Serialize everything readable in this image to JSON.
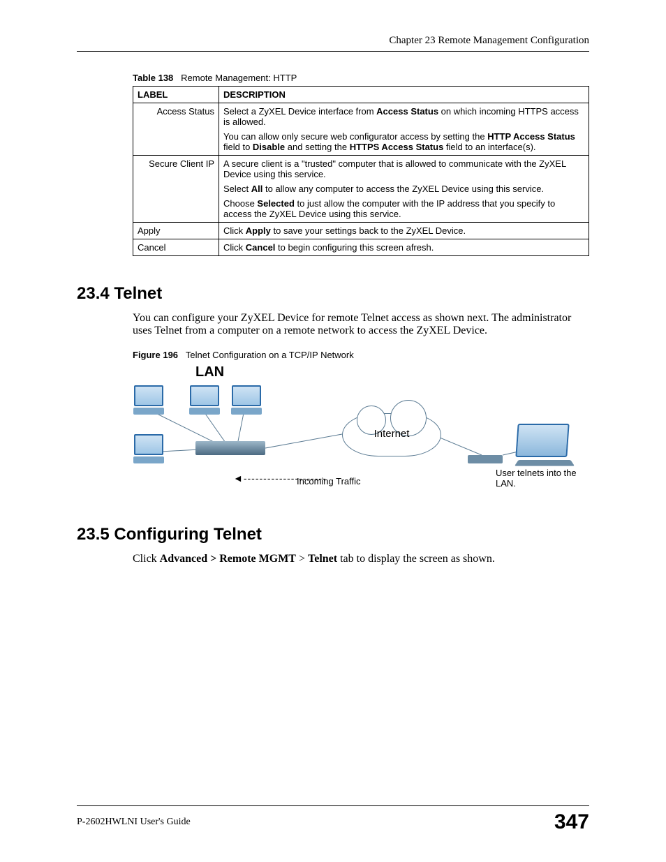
{
  "header": {
    "chapter": "Chapter 23 Remote Management Configuration"
  },
  "table": {
    "caption_num": "Table 138",
    "caption_text": "Remote Management: HTTP",
    "head": {
      "label": "LABEL",
      "desc": "DESCRIPTION"
    },
    "rows": {
      "access_status": {
        "label": "Access Status",
        "p1a": "Select a ZyXEL Device interface from ",
        "p1b": "Access Status",
        "p1c": " on which incoming HTTPS access is allowed.",
        "p2a": "You can allow only secure web configurator access by setting the ",
        "p2b": "HTTP Access Status",
        "p2c": " field to ",
        "p2d": "Disable",
        "p2e": " and setting the ",
        "p2f": "HTTPS Access Status",
        "p2g": " field to an interface(s)."
      },
      "secure_client": {
        "label": "Secure Client IP",
        "p1": "A secure client is a \"trusted\" computer that is allowed to communicate with the ZyXEL Device using this service.",
        "p2a": "Select ",
        "p2b": "All",
        "p2c": " to allow any computer to access the ZyXEL Device using this service.",
        "p3a": "Choose ",
        "p3b": "Selected",
        "p3c": " to just allow the computer with the IP address that you specify to access the ZyXEL Device using this service."
      },
      "apply": {
        "label": "Apply",
        "p1a": "Click ",
        "p1b": "Apply",
        "p1c": " to save your settings back to the ZyXEL Device."
      },
      "cancel": {
        "label": "Cancel",
        "p1a": "Click ",
        "p1b": "Cancel",
        "p1c": " to begin configuring this screen afresh."
      }
    }
  },
  "section_234": {
    "heading": "23.4  Telnet",
    "body": "You can configure your ZyXEL Device for remote Telnet access as shown next. The administrator uses Telnet from a computer on a remote network to access the ZyXEL Device."
  },
  "figure": {
    "caption_num": "Figure 196",
    "caption_text": "Telnet Configuration on a TCP/IP Network",
    "lan": "LAN",
    "internet": "Internet",
    "traffic": "Incoming Traffic",
    "arrow": "◄---------------------",
    "user": "User telnets into the LAN."
  },
  "section_235": {
    "heading": "23.5  Configuring Telnet",
    "body_pre": "Click ",
    "body_b1": "Advanced > Remote MGMT",
    "body_mid": " > ",
    "body_b2": "Telnet",
    "body_post": " tab to display the screen as shown."
  },
  "footer": {
    "guide": "P-2602HWLNI User's Guide",
    "page": "347"
  }
}
